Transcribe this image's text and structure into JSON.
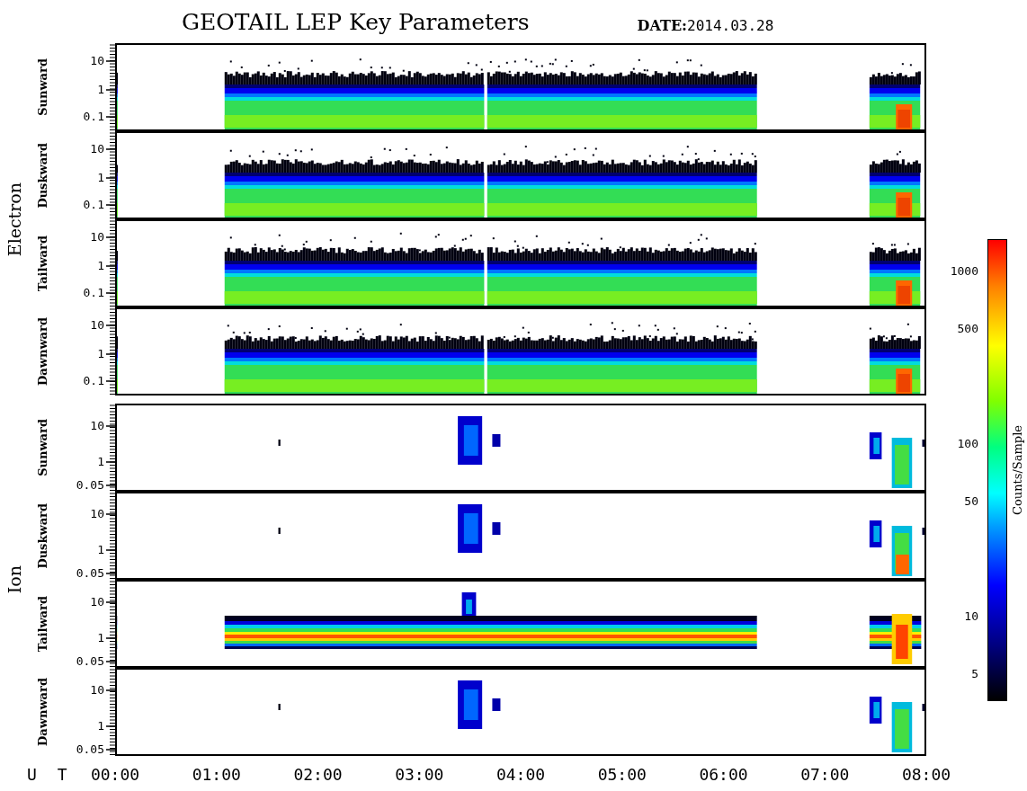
{
  "title": "GEOTAIL LEP Key Parameters",
  "date": {
    "label": "DATE:",
    "value": "2014.03.28"
  },
  "groups": [
    {
      "label": "Electron",
      "panels": [
        {
          "label": "Sunward",
          "yticks": [
            "10",
            "1",
            "0.1"
          ]
        },
        {
          "label": "Duskward",
          "yticks": [
            "10",
            "1",
            "0.1"
          ]
        },
        {
          "label": "Tailward",
          "yticks": [
            "10",
            "1",
            "0.1"
          ]
        },
        {
          "label": "Dawnward",
          "yticks": [
            "10",
            "1",
            "0.1"
          ]
        }
      ]
    },
    {
      "label": "Ion",
      "panels": [
        {
          "label": "Sunward",
          "yticks": [
            "10",
            "1",
            "0.05"
          ]
        },
        {
          "label": "Duskward",
          "yticks": [
            "10",
            "1",
            "0.05"
          ]
        },
        {
          "label": "Tailward",
          "yticks": [
            "10",
            "1",
            "0.05"
          ]
        },
        {
          "label": "Dawnward",
          "yticks": [
            "10",
            "1",
            "0.05"
          ]
        }
      ]
    }
  ],
  "x_axis": {
    "label": "U T",
    "ticks": [
      "00:00",
      "01:00",
      "02:00",
      "03:00",
      "04:00",
      "05:00",
      "06:00",
      "07:00",
      "08:00"
    ]
  },
  "colorbar": {
    "label": "Counts/Sample",
    "ticks": [
      "1000",
      "500",
      "100",
      "50",
      "10",
      "5"
    ]
  }
}
